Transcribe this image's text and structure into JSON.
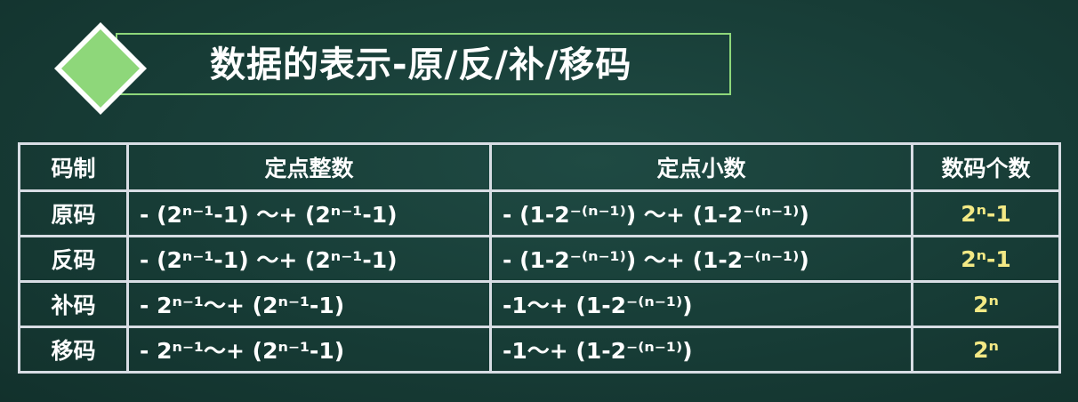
{
  "title": "数据的表示-原/反/补/移码",
  "table": {
    "headers": [
      "码制",
      "定点整数",
      "定点小数",
      "数码个数"
    ],
    "rows": [
      {
        "code": "原码",
        "integer": "- (2ⁿ⁻¹-1) ～+ (2ⁿ⁻¹-1)",
        "fraction": "- (1-2⁻⁽ⁿ⁻¹⁾) ～+ (1-2⁻⁽ⁿ⁻¹⁾)",
        "count": "2ⁿ-1"
      },
      {
        "code": "反码",
        "integer": "- (2ⁿ⁻¹-1) ～+ (2ⁿ⁻¹-1)",
        "fraction": "- (1-2⁻⁽ⁿ⁻¹⁾) ～+ (1-2⁻⁽ⁿ⁻¹⁾)",
        "count": "2ⁿ-1"
      },
      {
        "code": "补码",
        "integer": "- 2ⁿ⁻¹～+ (2ⁿ⁻¹-1)",
        "fraction": "-1～+ (1-2⁻⁽ⁿ⁻¹⁾)",
        "count": "2ⁿ"
      },
      {
        "code": "移码",
        "integer": "- 2ⁿ⁻¹～+ (2ⁿ⁻¹-1)",
        "fraction": "-1～+ (1-2⁻⁽ⁿ⁻¹⁾)",
        "count": "2ⁿ"
      }
    ]
  },
  "colors": {
    "background": "#173c36",
    "accent_green": "#8ed77a",
    "count_text": "#f3e985",
    "table_border": "#d8dde4"
  },
  "icons": {
    "title_marker": "diamond-icon"
  }
}
